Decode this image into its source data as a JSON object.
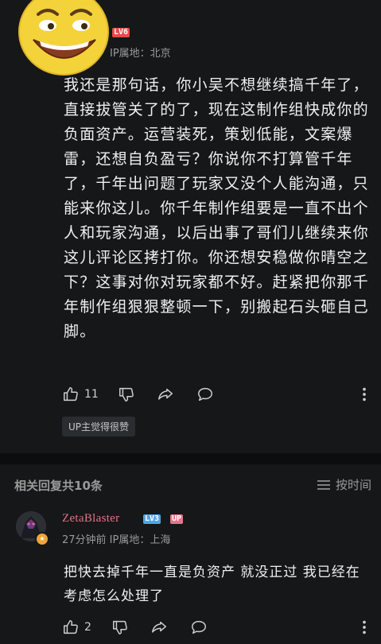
{
  "comment": {
    "level": "LV6",
    "ip_location": "IP属地：北京",
    "text": "我还是那句话，你小吴不想继续搞千年了，直接拔管关了的了，现在这制作组快成你的负面资产。运营装死，策划低能，文案爆雷，还想自负盈亏？你说你不打算管千年了，千年出问题了玩家又没个人能沟通，只能来你这儿。你千年制作组要是一直不出个人和玩家沟通，以后出事了哥们儿继续来你这儿评论区拷打你。你还想安稳做你晴空之下？这事对你对玩家都不好。赶紧把你那千年制作组狠狠整顿一下，别搬起石头砸自己脚。",
    "like_count": "11",
    "up_badge": "UP主觉得很赞"
  },
  "replies_section": {
    "title": "相关回复共10条",
    "sort_label": "按时间"
  },
  "reply": {
    "username": "ZetaBlaster",
    "level": "LV3",
    "up_tag": "UP",
    "meta": "27分钟前 IP属地：上海",
    "text": "把快去掉千年一直是负资产 就没正过 我已经在考虑怎么处理了",
    "like_count": "2"
  },
  "colors": {
    "background": "#151718",
    "username": "#e8728a",
    "level6": "#e84a4a",
    "level3": "#4da6e8"
  },
  "icons": [
    "emoji-grin-icon",
    "thumb-up-icon",
    "thumb-down-icon",
    "share-icon",
    "comment-icon",
    "more-vertical-icon",
    "sort-list-icon",
    "avatar-badge-icon"
  ]
}
